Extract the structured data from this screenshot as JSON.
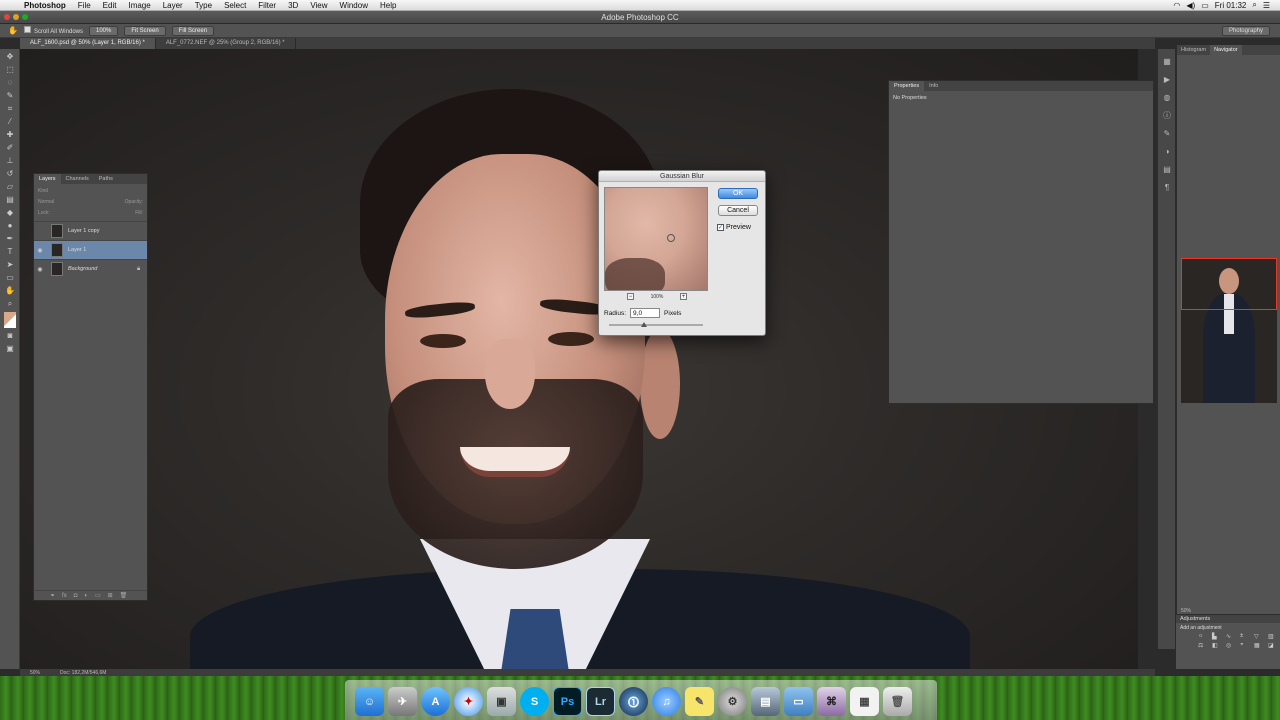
{
  "menubar": {
    "app": "Photoshop",
    "items": [
      "File",
      "Edit",
      "Image",
      "Layer",
      "Type",
      "Select",
      "Filter",
      "3D",
      "View",
      "Window",
      "Help"
    ],
    "clock": "Fri 01:32"
  },
  "window": {
    "title": "Adobe Photoshop CC"
  },
  "options": {
    "scroll_all_windows": "Scroll All Windows",
    "zoom_100": "100%",
    "fit_screen": "Fit Screen",
    "fill_screen": "Fill Screen",
    "workspace": "Photography"
  },
  "doc_tabs": [
    "ALF_1600.psd @ 50% (Layer 1, RGB/16) *",
    "ALF_0772.NEF @ 25% (Group 2, RGB/16) *"
  ],
  "layers_panel": {
    "tabs": [
      "Layers",
      "Channels",
      "Paths"
    ],
    "kind": "Kind",
    "blend": "Normal",
    "opacity_label": "Opacity:",
    "lock_label": "Lock:",
    "fill_label": "Fill:",
    "layers": [
      {
        "name": "Layer 1 copy",
        "visible": false,
        "selected": false
      },
      {
        "name": "Layer 1",
        "visible": true,
        "selected": true
      },
      {
        "name": "Background",
        "visible": true,
        "selected": false,
        "locked": true
      }
    ]
  },
  "properties_panel": {
    "tabs": [
      "Properties",
      "Info"
    ],
    "text": "No Properties"
  },
  "navigator_panel": {
    "tabs": [
      "Histogram",
      "Navigator"
    ],
    "zoom": "50%"
  },
  "adjustments_panel": {
    "title": "Adjustments",
    "subtitle": "Add an adjustment"
  },
  "statusbar": {
    "zoom": "50%",
    "doc": "Doc: 182,2M/546,6M"
  },
  "gaussian_blur": {
    "title": "Gaussian Blur",
    "ok": "OK",
    "cancel": "Cancel",
    "preview": "Preview",
    "preview_checked": true,
    "zoom": "100%",
    "radius_label": "Radius:",
    "radius_value": "9,0",
    "radius_unit": "Pixels"
  },
  "dock": [
    "Finder",
    "Migration",
    "App Store",
    "Safari",
    "iPhoto",
    "Skype",
    "Photoshop",
    "Lightroom",
    "Utility",
    "iTunes",
    "Stickies",
    "System Preferences",
    "Preview",
    "Folder",
    "Archive",
    "Document",
    "Trash"
  ],
  "colors": {
    "accent": "#3c8be6",
    "panel_bg": "#535353",
    "selection": "#6b87aa"
  }
}
